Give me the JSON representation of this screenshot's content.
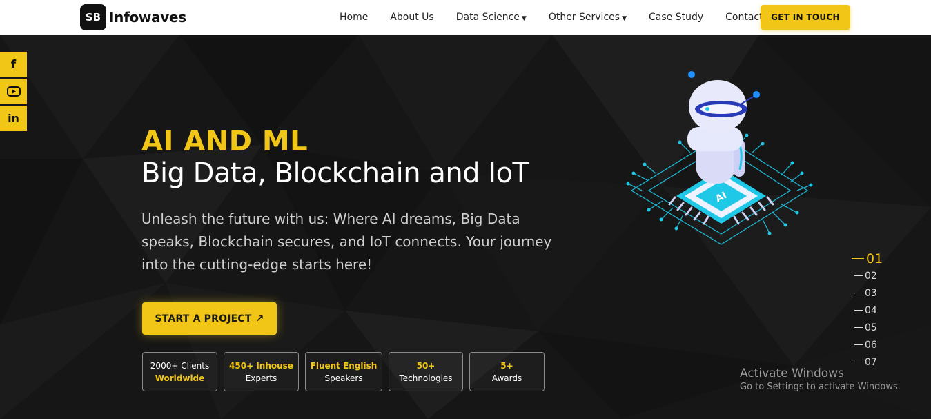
{
  "brand": {
    "badge": "SB",
    "name": "Infowaves"
  },
  "nav": {
    "items": [
      {
        "label": "Home",
        "dropdown": false
      },
      {
        "label": "About Us",
        "dropdown": false
      },
      {
        "label": "Data Science",
        "dropdown": true
      },
      {
        "label": "Other Services",
        "dropdown": true
      },
      {
        "label": "Case Study",
        "dropdown": false
      },
      {
        "label": "Contact",
        "dropdown": false
      }
    ],
    "cta": "GET IN TOUCH"
  },
  "social": [
    {
      "icon": "facebook-icon",
      "glyph": "f"
    },
    {
      "icon": "youtube-icon",
      "glyph": "▶"
    },
    {
      "icon": "linkedin-icon",
      "glyph": "in"
    }
  ],
  "hero": {
    "eyebrow": "AI AND ML",
    "headline": "Big Data, Blockchain and IoT",
    "description": "Unleash the future with us: Where AI dreams, Big Data speaks, Blockchain secures, and IoT connects. Your journey into the cutting-edge starts here!",
    "button": "START A PROJECT",
    "button_icon": "↗",
    "chip_label": "AI"
  },
  "stats": [
    {
      "line1": "2000+ Clients",
      "line2": "Worldwide",
      "highlight": "line2"
    },
    {
      "line1": "450+ Inhouse",
      "line2": "Experts",
      "highlight": "line1"
    },
    {
      "line1": "Fluent English",
      "line2": "Speakers",
      "highlight": "line1"
    },
    {
      "line1": "50+",
      "line2": "Technologies",
      "highlight": "line1"
    },
    {
      "line1": "5+",
      "line2": "Awards",
      "highlight": "line1"
    }
  ],
  "pager": {
    "items": [
      "01",
      "02",
      "03",
      "04",
      "05",
      "06",
      "07"
    ],
    "active": 0
  },
  "watermark": {
    "title": "Activate Windows",
    "subtitle": "Go to Settings to activate Windows."
  },
  "colors": {
    "accent": "#f2c617",
    "background": "#151515",
    "circuit": "#1ec8e6"
  }
}
